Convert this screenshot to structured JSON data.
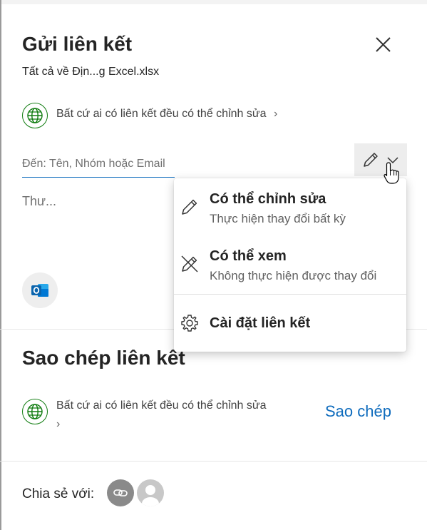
{
  "panel": {
    "title": "Gửi liên kết",
    "filename": "Tất cả về Địn...g Excel.xlsx",
    "permission_link": "Bất cứ ai có liên kết đều có thể chỉnh sửa",
    "to_placeholder": "Đến: Tên, Nhóm hoặc Email",
    "message_placeholder": "Thư..."
  },
  "copy_section": {
    "title": "Sao chép liên kết",
    "permission": "Bất cứ ai có liên kết đều có thể chỉnh sửa",
    "copy_button": "Sao chép"
  },
  "share_section": {
    "label": "Chia sẻ với:"
  },
  "menu": {
    "items": [
      {
        "title": "Có thể chỉnh sửa",
        "description": "Thực hiện thay đổi bất kỳ",
        "icon": "pencil-icon"
      },
      {
        "title": "Có thể xem",
        "description": "Không thực hiện được thay đổi",
        "icon": "pencil-off-icon"
      },
      {
        "title": "Cài đặt liên kết",
        "description": "",
        "icon": "gear-icon"
      }
    ]
  },
  "colors": {
    "accent": "#0f6cbd",
    "globe": "#107c10",
    "outlook": "#0a64ad"
  }
}
